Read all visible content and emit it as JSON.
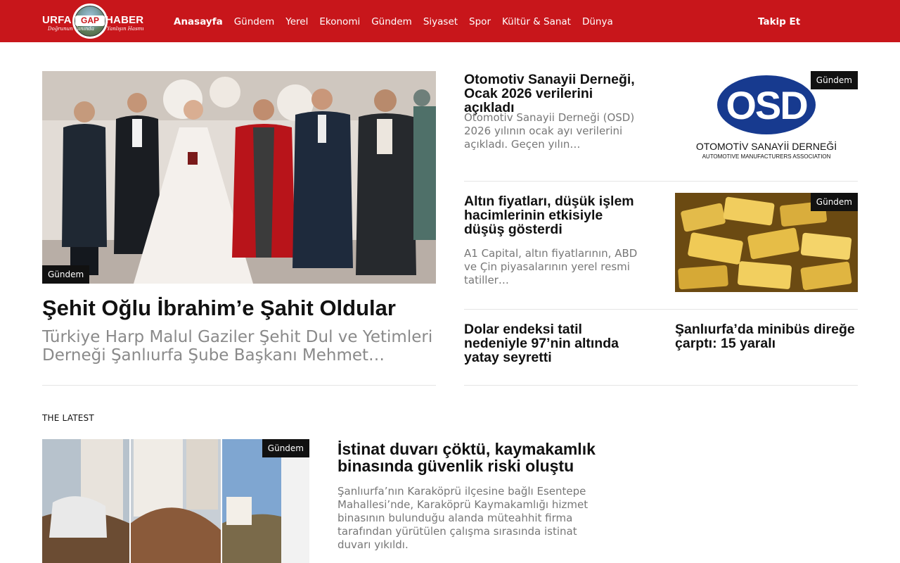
{
  "header": {
    "logo": {
      "word_left": "URFA",
      "word_center": "GAP",
      "word_right": "HABER",
      "tagline_left": "Doğrunun Yanında",
      "tagline_right": "Yanlışın Hasmı"
    },
    "nav": [
      {
        "label": "Anasayfa",
        "active": true
      },
      {
        "label": "Gündem"
      },
      {
        "label": "Yerel"
      },
      {
        "label": "Ekonomi"
      },
      {
        "label": "Gündem"
      },
      {
        "label": "Siyaset"
      },
      {
        "label": "Spor"
      },
      {
        "label": "Kültür & Sanat"
      },
      {
        "label": "Dünya"
      }
    ],
    "follow_label": "Takip Et",
    "brand_color": "#c8161b"
  },
  "hero": {
    "category": "Gündem",
    "title": "Şehit Oğlu İbrahim’e Şahit Oldular",
    "excerpt": "Türkiye Harp Malul Gaziler Şehit Dul ve Yetimleri Derneği Şanlıurfa Şube Başkanı Mehmet…"
  },
  "side_articles": [
    {
      "category": "Gündem",
      "title": "Otomotiv Sanayii Derneği, Ocak 2026 verilerini açıkladı",
      "excerpt": "Otomotiv Sanayii Derneği (OSD) 2026 yılının ocak ayı verilerini açıkladı. Geçen yılın…",
      "image": {
        "logo_text": "OSD",
        "name": "OTOMOTİV SANAYİİ DERNEĞİ",
        "subtitle": "AUTOMOTIVE MANUFACTURERS ASSOCIATION"
      }
    },
    {
      "category": "Gündem",
      "title": "Altın fiyatları, düşük işlem hacimlerinin etkisiyle düşüş gösterdi",
      "excerpt": "A1 Capital, altın fiyatlarının, ABD ve Çin piyasalarının yerel resmi tatiller…"
    },
    {
      "title": "Dolar endeksi tatil nedeniyle 97’nin altında yatay seyretti"
    },
    {
      "title": "Şanlıurfa’da minibüs direğe çarptı: 15 yaralı"
    }
  ],
  "latest": {
    "section_label": "THE LATEST",
    "category": "Gündem",
    "title": "İstinat duvarı çöktü, kaymakamlık binasında güvenlik riski oluştu",
    "excerpt": "Şanlıurfa’nın Karaköprü ilçesine bağlı Esentepe Mahallesi’nde, Karaköprü Kaymakamlığı hizmet binasının bulunduğu alanda müteahhit firma tarafından yürütülen çalışma sırasında istinat duvarı yıkıldı."
  }
}
